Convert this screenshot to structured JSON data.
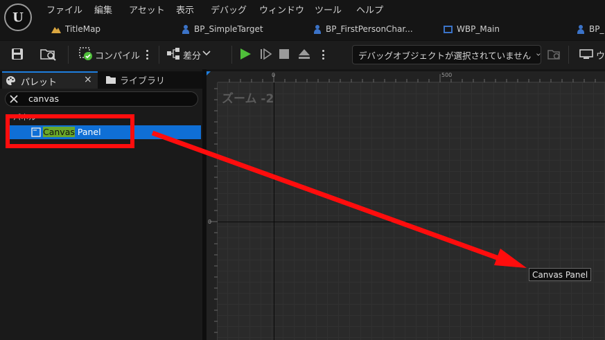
{
  "menu": [
    "ファイル",
    "編集",
    "アセット",
    "表示",
    "デバッグ",
    "ウィンドウ",
    "ツール",
    "ヘルプ"
  ],
  "tabs": [
    {
      "label": "TitleMap",
      "icon": "map-icon"
    },
    {
      "label": "BP_SimpleTarget",
      "icon": "blueprint-icon"
    },
    {
      "label": "BP_FirstPersonChar...",
      "icon": "blueprint-icon"
    },
    {
      "label": "WBP_Main",
      "icon": "widget-blueprint-icon"
    },
    {
      "label": "BP_",
      "icon": "blueprint-icon"
    }
  ],
  "toolbar": {
    "compile_label": "コンパイル",
    "diff_label": "差分",
    "debug_object": "デバッグオブジェクトが選択されていません",
    "right_label": "ウ"
  },
  "panel": {
    "palette_tab": "パレット",
    "library_tab": "ライブラリ",
    "search_value": "canvas",
    "section_header": "パネル",
    "result_highlight": "Canvas",
    "result_rest": " Panel"
  },
  "canvas": {
    "ruler_x": [
      "0",
      "500"
    ],
    "ruler_y": [
      "0"
    ],
    "zoom": "ズーム -2",
    "tooltip": "Canvas Panel"
  },
  "colors": {
    "accent": "#0f6fd6",
    "annotation": "#ff0d0d",
    "match_highlight": "#6aa82a",
    "play_green": "#4fbf3a"
  }
}
